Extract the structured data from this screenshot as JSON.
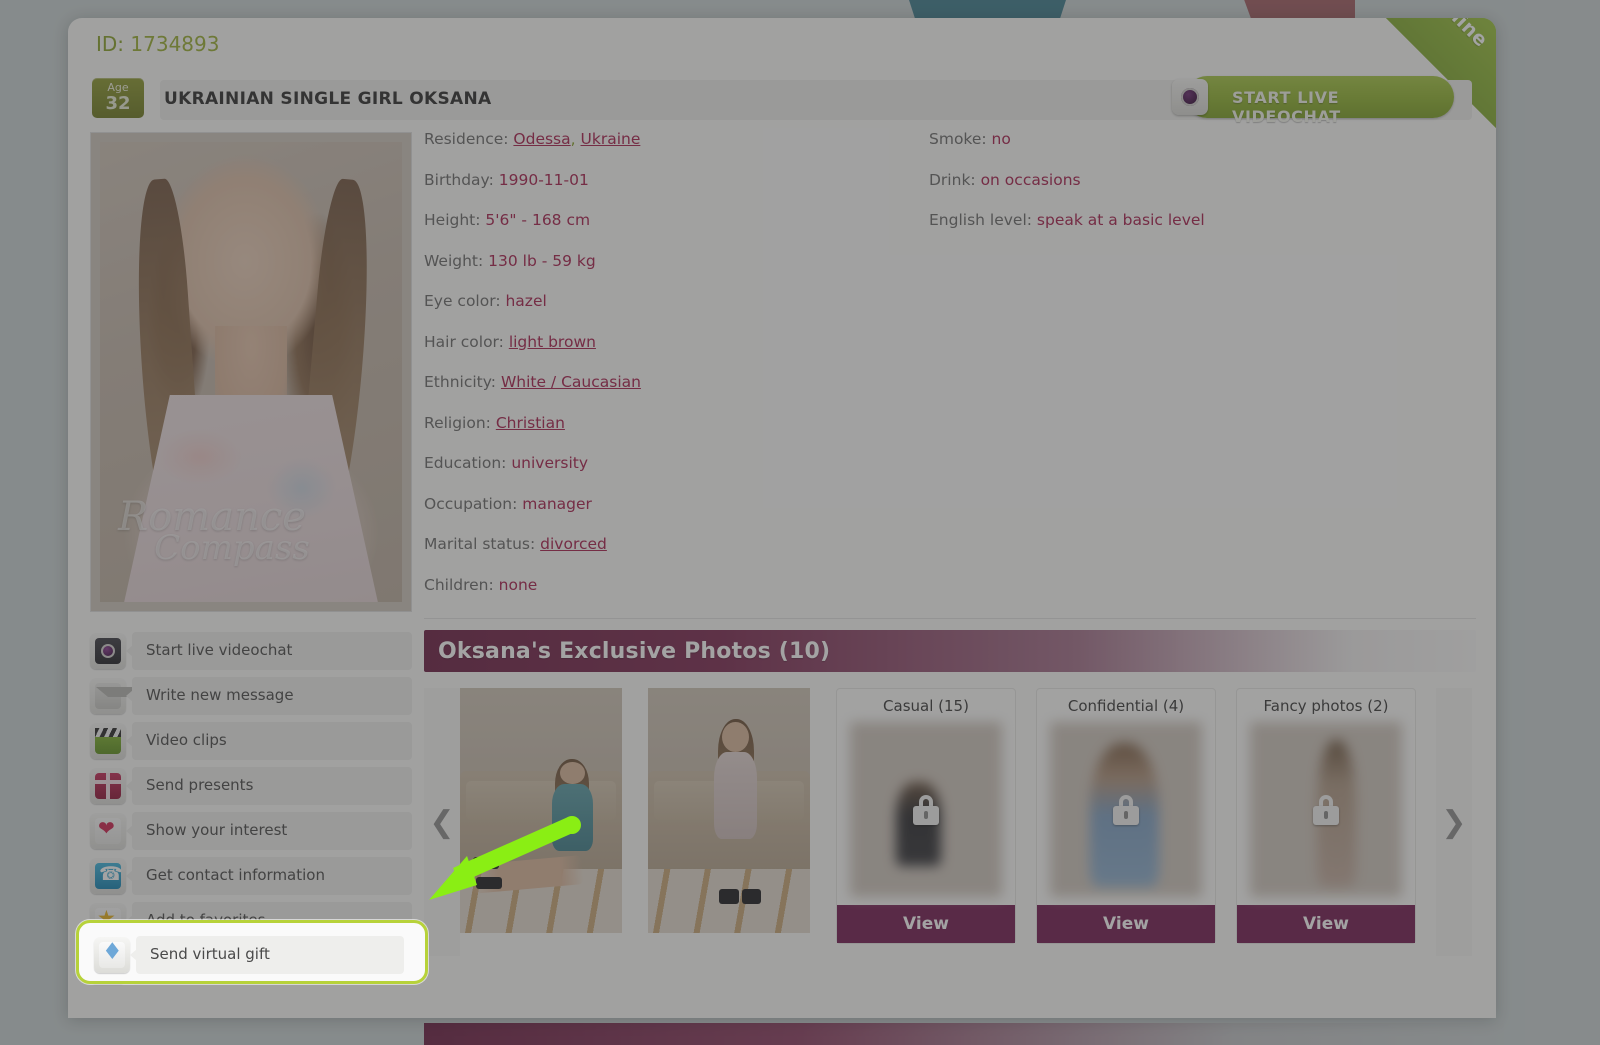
{
  "profile": {
    "id_label": "ID:",
    "id_value": "1734893",
    "age_label": "Age",
    "age_value": "32",
    "title": "UKRAINIAN SINGLE GIRL OKSANA",
    "online_badge": "online",
    "watermark_line1": "Romance",
    "watermark_line2": "Compass"
  },
  "videochat_button": {
    "label": "START LIVE VIDEOCHAT",
    "icon": "webcam-icon"
  },
  "details_left": [
    {
      "label": "Residence:",
      "value": "Odessa, Ukraine",
      "parts": [
        {
          "text": "Odessa",
          "link": true
        },
        {
          "text": ", ",
          "link": false
        },
        {
          "text": "Ukraine",
          "link": true
        }
      ]
    },
    {
      "label": "Birthday:",
      "value": "1990-11-01",
      "link": false
    },
    {
      "label": "Height:",
      "value": "5'6\" - 168 cm",
      "link": false
    },
    {
      "label": "Weight:",
      "value": "130 lb - 59 kg",
      "link": false
    },
    {
      "label": "Eye color:",
      "value": "hazel",
      "link": false
    },
    {
      "label": "Hair color:",
      "value": "light brown",
      "link": true
    },
    {
      "label": "Ethnicity:",
      "value": "White / Caucasian",
      "link": true
    },
    {
      "label": "Religion:",
      "value": "Christian",
      "link": true
    },
    {
      "label": "Education:",
      "value": "university",
      "link": false
    },
    {
      "label": "Occupation:",
      "value": "manager",
      "link": false
    },
    {
      "label": "Marital status:",
      "value": "divorced",
      "link": true
    },
    {
      "label": "Children:",
      "value": "none",
      "link": false
    }
  ],
  "details_right": [
    {
      "label": "Smoke:",
      "value": "no",
      "link": false
    },
    {
      "label": "Drink:",
      "value": "on occasions",
      "link": false
    },
    {
      "label": "English level:",
      "value": "speak at a basic level",
      "link": false
    }
  ],
  "actions": [
    {
      "label": "Start live videochat",
      "icon": "webcam-icon",
      "css": "cam"
    },
    {
      "label": "Write new message",
      "icon": "envelope-icon",
      "css": "mail"
    },
    {
      "label": "Video clips",
      "icon": "clapperboard-icon",
      "css": "clip"
    },
    {
      "label": "Send presents",
      "icon": "gift-box-icon",
      "css": "gift"
    },
    {
      "label": "Show your interest",
      "icon": "heart-icon",
      "css": "heart"
    },
    {
      "label": "Get contact information",
      "icon": "phone-icon",
      "css": "phone"
    },
    {
      "label": "Add to favorites",
      "icon": "star-icon",
      "css": "star"
    },
    {
      "label": "Send virtual gift",
      "icon": "diamond-icon",
      "css": "diamond"
    }
  ],
  "highlighted_action": {
    "label": "Send virtual gift",
    "icon": "diamond-icon"
  },
  "photos": {
    "header": "Oksana's Exclusive Photos (10)",
    "prev_icon": "chevron-left-icon",
    "next_icon": "chevron-right-icon",
    "sets": [
      {
        "caption": "Casual (15)",
        "button": "View",
        "lock": "lock-icon",
        "scene": "scene-a"
      },
      {
        "caption": "Confidential (4)",
        "button": "View",
        "lock": "lock-icon",
        "scene": "scene-b"
      },
      {
        "caption": "Fancy photos (2)",
        "button": "View",
        "lock": "lock-icon",
        "scene": "scene-c"
      }
    ]
  },
  "colors": {
    "accent_green": "#8aa32a",
    "accent_maroon": "#741c52",
    "value_pink": "#a8204f",
    "highlight_border": "#b7d23a",
    "arrow_green": "#8aee14"
  }
}
